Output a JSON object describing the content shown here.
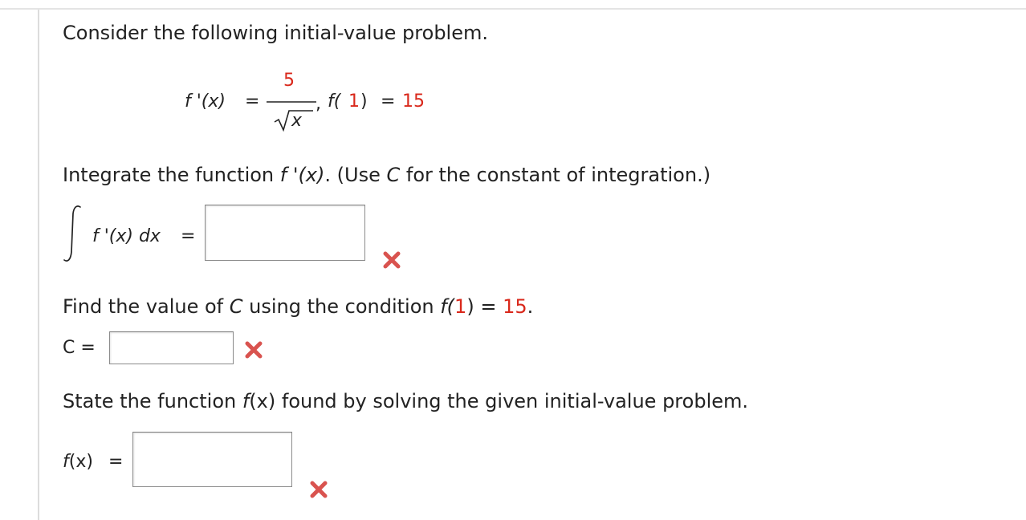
{
  "question": {
    "intro": "Consider the following initial-value problem.",
    "derivative_lhs": "f '(x)",
    "equals": "=",
    "numerator": "5",
    "denominator_var": "x",
    "comma": ",",
    "initial_fn": "f(",
    "initial_arg": "1",
    "initial_close": ")",
    "initial_value": "15"
  },
  "part1": {
    "instruction_before": "Integrate the function ",
    "instruction_fn": "f '(x)",
    "instruction_mid": ". (Use ",
    "instruction_c": "C",
    "instruction_after": " for the constant of integration.)",
    "integrand": "f '(x) dx",
    "equals": "=",
    "answer_value": "",
    "status_icon": "red-x-icon"
  },
  "part2": {
    "instruction_before": "Find the value of ",
    "instruction_c": "C",
    "instruction_mid": " using the condition ",
    "instruction_fn": "f(",
    "instruction_arg": "1",
    "instruction_close": ")",
    "instruction_eq": " = ",
    "instruction_value": "15",
    "instruction_end": ".",
    "label": "C =",
    "answer_value": "",
    "status_icon": "red-x-icon"
  },
  "part3": {
    "instruction_before": "State the function ",
    "instruction_fn": "f",
    "instruction_arg": "(x)",
    "instruction_after": " found by solving the given initial-value problem.",
    "label_fn": "f",
    "label_arg": "(x)",
    "equals": "=",
    "answer_value": "",
    "status_icon": "red-x-icon"
  },
  "colors": {
    "accent_red": "#d9281b",
    "text": "#222222",
    "wrong_mark": "#d9534f"
  }
}
